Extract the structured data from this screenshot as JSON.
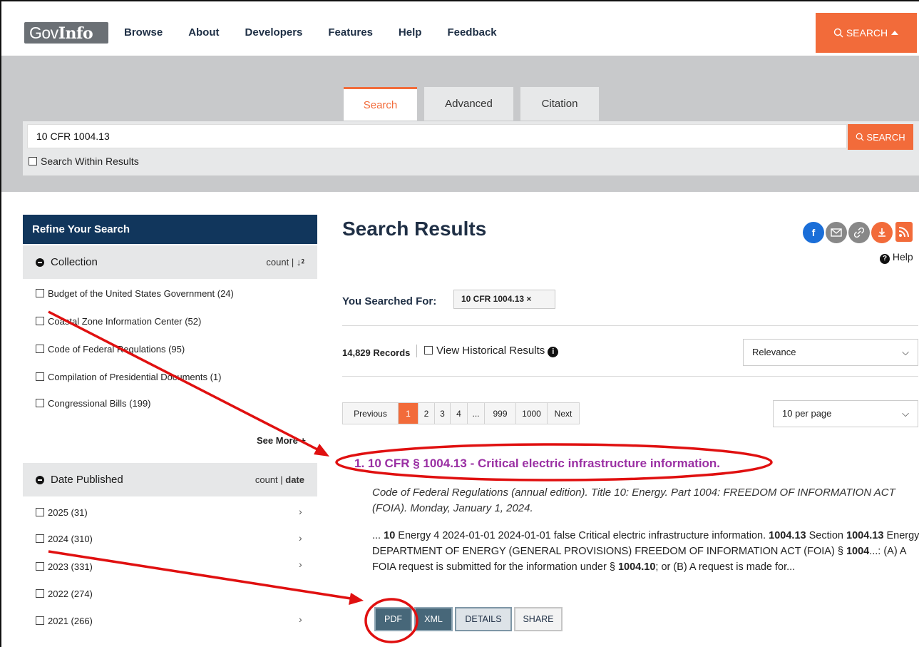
{
  "brand": {
    "logo_light": "Gov",
    "logo_bold": "Info"
  },
  "nav": {
    "links": [
      "Browse",
      "About",
      "Developers",
      "Features",
      "Help",
      "Feedback"
    ],
    "search_button": "SEARCH"
  },
  "search_panel": {
    "tabs": [
      {
        "label": "Search",
        "active": true
      },
      {
        "label": "Advanced",
        "active": false
      },
      {
        "label": "Citation",
        "active": false
      }
    ],
    "query_value": "10 CFR 1004.13",
    "search_button": "SEARCH",
    "within_label": "Search Within Results"
  },
  "sidebar": {
    "title": "Refine Your Search",
    "collection": {
      "label": "Collection",
      "sort": "count | ",
      "sort_glyph": "↓⁲",
      "items": [
        "Budget of the United States Government (24)",
        "Coastal Zone Information Center (52)",
        "Code of Federal Regulations (95)",
        "Compilation of Presidential Documents (1)",
        "Congressional Bills (199)"
      ],
      "see_more": "See More +"
    },
    "date_published": {
      "label": "Date Published",
      "sort_count": "count | ",
      "sort_date": "date",
      "items": [
        "2025 (31)",
        "2024 (310)",
        "2023 (331)",
        "2022 (274)",
        "2021 (266)"
      ]
    }
  },
  "results": {
    "title": "Search Results",
    "help_label": "Help",
    "share_icons": [
      "facebook-icon",
      "email-icon",
      "link-icon",
      "download-icon",
      "rss-icon"
    ],
    "searched_for_label": "You Searched For:",
    "searched_term": "10 CFR 1004.13  ×",
    "records_count": "14,829 Records",
    "historical_label": "View Historical Results",
    "sort_select": "Relevance",
    "per_page_select": "10 per page",
    "pagination": [
      "Previous",
      "1",
      "2",
      "3",
      "4",
      "...",
      "999",
      "1000",
      "Next"
    ],
    "current_page": "1",
    "first_result": {
      "number": "1.",
      "title": "10 CFR § 1004.13 - Critical electric infrastructure information.",
      "description": "Code of Federal Regulations (annual edition). Title 10: Energy. Part 1004: FREEDOM OF INFORMATION ACT (FOIA). Monday, January 1, 2024.",
      "snippet_parts": [
        "... ",
        "10",
        " Energy 4 2024-01-01 2024-01-01 false Critical electric infrastructure information. ",
        "1004",
        ".",
        "13",
        " Section ",
        "1004",
        ".",
        "13",
        " Energy DEPARTMENT OF ENERGY (GENERAL PROVISIONS) FREEDOM OF INFORMATION ACT (FOIA) § ",
        "1004",
        "...: (A) A FOIA request is submitted for the information under § ",
        "1004",
        ".",
        "10",
        "; or (B) A request is made for..."
      ],
      "buttons": [
        "PDF",
        "XML",
        "DETAILS",
        "SHARE"
      ]
    }
  },
  "colors": {
    "accent": "#f26b3a",
    "navy": "#11365c",
    "annotation_red": "#e01010",
    "result_title": "#9a2fa3"
  }
}
